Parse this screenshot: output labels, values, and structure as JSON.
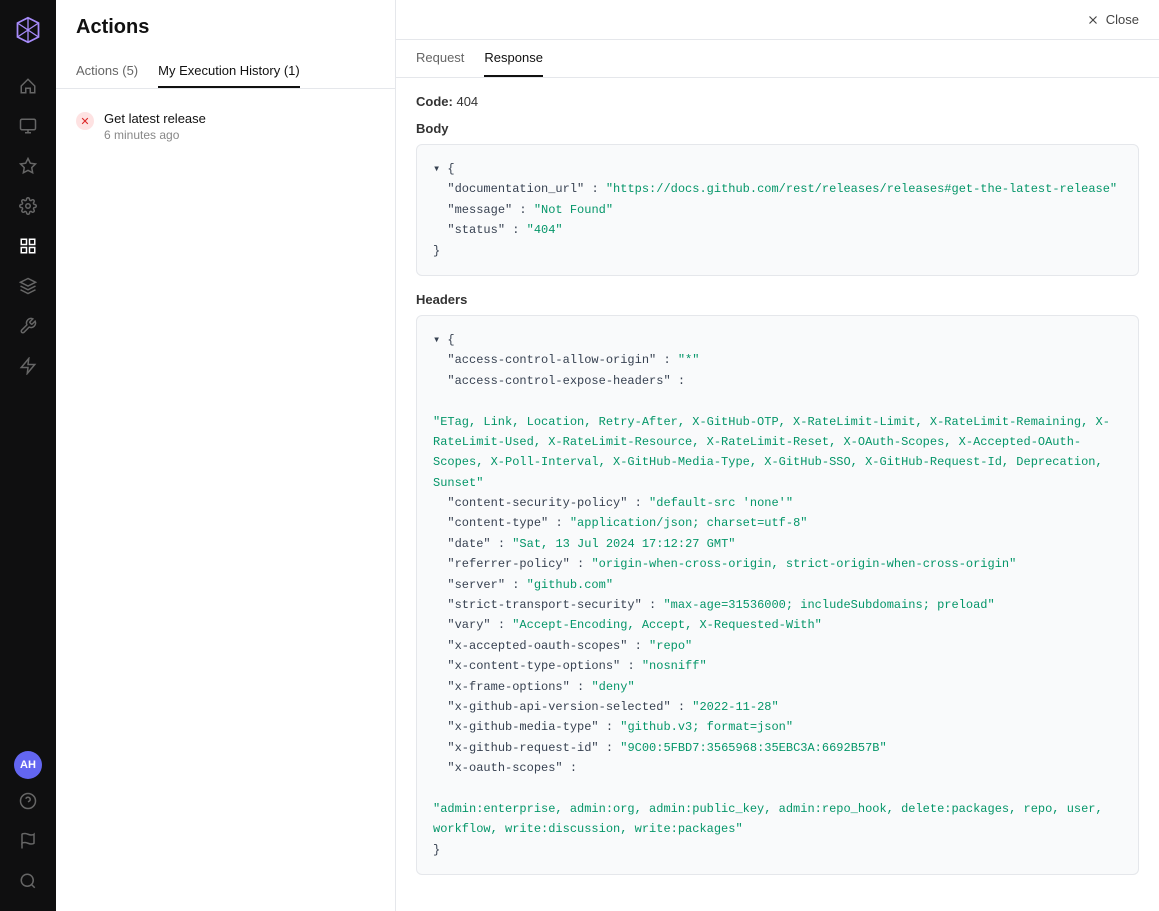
{
  "sidebar": {
    "logo_label": "Logo",
    "items": [
      {
        "name": "home",
        "icon": "⌂",
        "active": false
      },
      {
        "name": "box",
        "icon": "◻",
        "active": false
      },
      {
        "name": "star",
        "icon": "★",
        "active": false
      },
      {
        "name": "settings",
        "icon": "⚙",
        "active": false
      },
      {
        "name": "terminal",
        "icon": "▣",
        "active": true
      },
      {
        "name": "rocket",
        "icon": "🚀",
        "active": false
      },
      {
        "name": "tools",
        "icon": "⚒",
        "active": false
      },
      {
        "name": "lightning",
        "icon": "⚡",
        "active": false
      }
    ],
    "bottom_items": [
      {
        "name": "avatar",
        "label": "AH"
      },
      {
        "name": "help",
        "icon": "?"
      },
      {
        "name": "flag",
        "icon": "⚑"
      },
      {
        "name": "search",
        "icon": "🔍"
      }
    ]
  },
  "left_panel": {
    "title": "Actions",
    "tabs": [
      {
        "label": "Actions (5)",
        "active": false
      },
      {
        "label": "My Execution History (1)",
        "active": true
      }
    ],
    "actions": [
      {
        "status": "error",
        "name": "Get latest release",
        "time": "6 minutes ago"
      }
    ]
  },
  "right_panel": {
    "close_label": "Close",
    "response_tabs": [
      {
        "label": "Request",
        "active": false
      },
      {
        "label": "Response",
        "active": true
      }
    ],
    "code_label": "Code:",
    "code_value": "404",
    "body_label": "Body",
    "body_json": {
      "documentation_url_key": "\"documentation_url\"",
      "documentation_url_val": "\"https://docs.github.com/rest/releases/releases#get-the-latest-release\"",
      "message_key": "\"message\"",
      "message_val": "\"Not Found\"",
      "status_key": "\"status\"",
      "status_val": "\"404\""
    },
    "headers_label": "Headers",
    "headers_json": {
      "access_control_allow_origin_key": "\"access-control-allow-origin\"",
      "access_control_allow_origin_val": "\"*\"",
      "access_control_expose_headers_key": "\"access-control-expose-headers\"",
      "access_control_expose_headers_val": "\"ETag, Link, Location, Retry-After, X-GitHub-OTP, X-RateLimit-Limit, X-RateLimit-Remaining, X-RateLimit-Used, X-RateLimit-Resource, X-RateLimit-Reset, X-OAuth-Scopes, X-Accepted-OAuth-Scopes, X-Poll-Interval, X-GitHub-Media-Type, X-GitHub-SSO, X-GitHub-Request-Id, Deprecation, Sunset\"",
      "content_security_policy_key": "\"content-security-policy\"",
      "content_security_policy_val": "\"default-src 'none'\"",
      "content_type_key": "\"content-type\"",
      "content_type_val": "\"application/json; charset=utf-8\"",
      "date_key": "\"date\"",
      "date_val": "\"Sat, 13 Jul 2024 17:12:27 GMT\"",
      "referrer_policy_key": "\"referrer-policy\"",
      "referrer_policy_val": "\"origin-when-cross-origin, strict-origin-when-cross-origin\"",
      "server_key": "\"server\"",
      "server_val": "\"github.com\"",
      "strict_transport_security_key": "\"strict-transport-security\"",
      "strict_transport_security_val": "\"max-age=31536000; includeSubdomains; preload\"",
      "vary_key": "\"vary\"",
      "vary_val": "\"Accept-Encoding, Accept, X-Requested-With\"",
      "x_accepted_oauth_scopes_key": "\"x-accepted-oauth-scopes\"",
      "x_accepted_oauth_scopes_val": "\"repo\"",
      "x_content_type_options_key": "\"x-content-type-options\"",
      "x_content_type_options_val": "\"nosniff\"",
      "x_frame_options_key": "\"x-frame-options\"",
      "x_frame_options_val": "\"deny\"",
      "x_github_api_version_selected_key": "\"x-github-api-version-selected\"",
      "x_github_api_version_selected_val": "\"2022-11-28\"",
      "x_github_media_type_key": "\"x-github-media-type\"",
      "x_github_media_type_val": "\"github.v3; format=json\"",
      "x_github_request_id_key": "\"x-github-request-id\"",
      "x_github_request_id_val": "\"9C00:5FBD7:3565968:35EBC3A:6692B57B\"",
      "x_oauth_scopes_key": "\"x-oauth-scopes\"",
      "x_oauth_scopes_val": "\"admin:enterprise, admin:org, admin:public_key, admin:repo_hook, delete:packages, repo, user, workflow, write:discussion, write:packages\""
    }
  }
}
